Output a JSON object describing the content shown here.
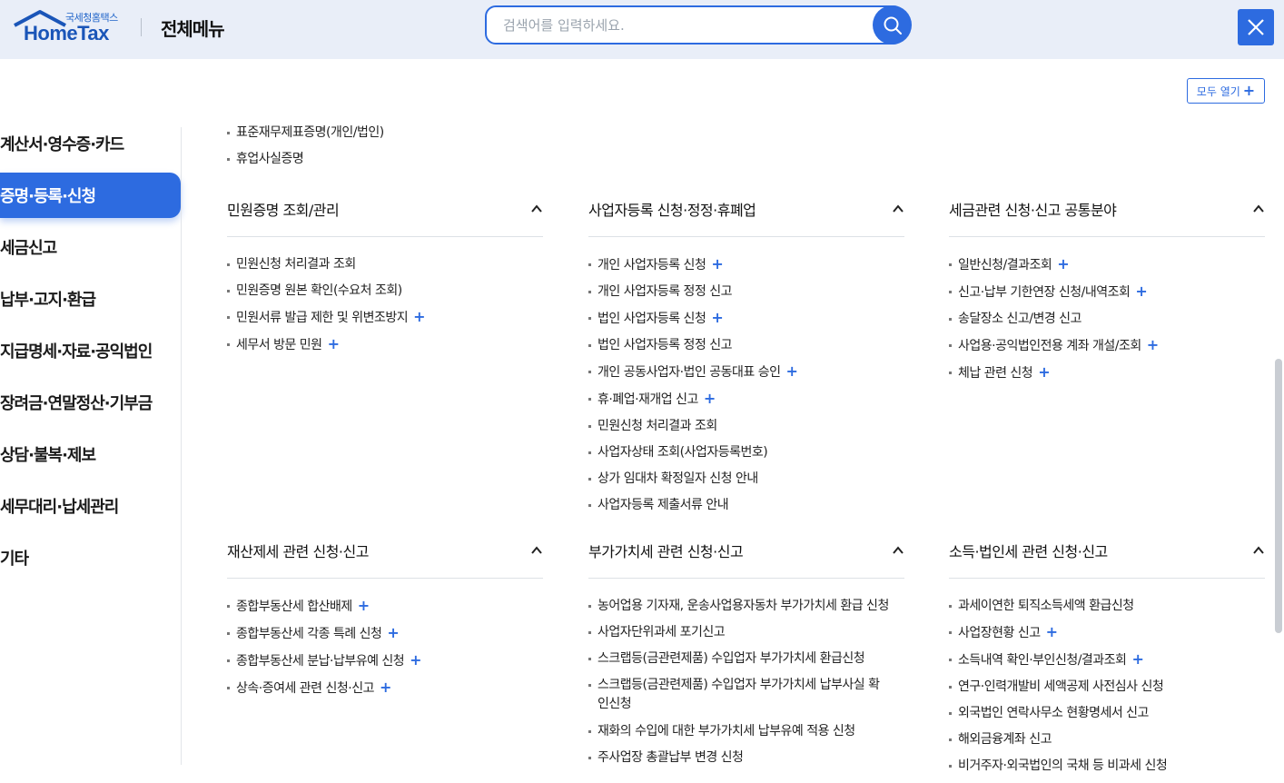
{
  "header": {
    "logo_sub": "국세청홈택스",
    "logo_main": "HomeTax",
    "title": "전체메뉴",
    "search_placeholder": "검색어를 입력하세요."
  },
  "toolbar": {
    "open_all_label": "모두 열기"
  },
  "sidebar": {
    "items": [
      {
        "label": "계산서·영수증·카드",
        "active": false
      },
      {
        "label": "증명·등록·신청",
        "active": true
      },
      {
        "label": "세금신고",
        "active": false
      },
      {
        "label": "납부·고지·환급",
        "active": false
      },
      {
        "label": "지급명세·자료·공익법인",
        "active": false
      },
      {
        "label": "장려금·연말정산·기부금",
        "active": false
      },
      {
        "label": "상담·불복·제보",
        "active": false
      },
      {
        "label": "세무대리·납세관리",
        "active": false
      },
      {
        "label": "기타",
        "active": false
      }
    ]
  },
  "top_items": [
    {
      "label": "표준재무제표증명(개인/법인)"
    },
    {
      "label": "휴업사실증명"
    }
  ],
  "sections": [
    {
      "title": "민원증명 조회/관리",
      "items": [
        {
          "label": "민원신청 처리결과 조회",
          "plus": false
        },
        {
          "label": "민원증명 원본 확인(수요처 조회)",
          "plus": false
        },
        {
          "label": "민원서류 발급 제한 및 위변조방지",
          "plus": true
        },
        {
          "label": "세무서 방문 민원",
          "plus": true
        }
      ]
    },
    {
      "title": "사업자등록 신청·정정·휴폐업",
      "items": [
        {
          "label": "개인 사업자등록 신청",
          "plus": true
        },
        {
          "label": "개인 사업자등록 정정 신고",
          "plus": false
        },
        {
          "label": "법인 사업자등록 신청",
          "plus": true
        },
        {
          "label": "법인 사업자등록 정정 신고",
          "plus": false
        },
        {
          "label": "개인 공동사업자·법인 공동대표 승인",
          "plus": true
        },
        {
          "label": "휴·폐업·재개업 신고",
          "plus": true
        },
        {
          "label": "민원신청 처리결과 조회",
          "plus": false
        },
        {
          "label": "사업자상태 조회(사업자등록번호)",
          "plus": false
        },
        {
          "label": "상가 임대차 확정일자 신청 안내",
          "plus": false
        },
        {
          "label": "사업자등록 제출서류 안내",
          "plus": false
        }
      ]
    },
    {
      "title": "세금관련 신청·신고 공통분야",
      "items": [
        {
          "label": "일반신청/결과조회",
          "plus": true
        },
        {
          "label": "신고·납부 기한연장 신청/내역조회",
          "plus": true
        },
        {
          "label": "송달장소 신고/변경 신고",
          "plus": false
        },
        {
          "label": "사업용·공익법인전용 계좌 개설/조회",
          "plus": true
        },
        {
          "label": "체납 관련 신청",
          "plus": true
        }
      ]
    },
    {
      "title": "재산제세 관련 신청·신고",
      "items": [
        {
          "label": "종합부동산세 합산배제",
          "plus": true
        },
        {
          "label": "종합부동산세 각종 특례 신청",
          "plus": true
        },
        {
          "label": "종합부동산세 분납·납부유예 신청",
          "plus": true
        },
        {
          "label": "상속·증여세 관련 신청·신고",
          "plus": true
        }
      ]
    },
    {
      "title": "부가가치세 관련 신청·신고",
      "items": [
        {
          "label": "농어업용 기자재, 운송사업용자동차 부가가치세 환급 신청",
          "plus": false
        },
        {
          "label": "사업자단위과세 포기신고",
          "plus": false
        },
        {
          "label": "스크랩등(금관련제품) 수입업자 부가가치세 환급신청",
          "plus": false
        },
        {
          "label": "스크랩등(금관련제품) 수입업자 부가가치세 납부사실 확인신청",
          "plus": false,
          "wrap": true
        },
        {
          "label": "재화의 수입에 대한 부가가치세 납부유예 적용 신청",
          "plus": false
        },
        {
          "label": "주사업장 총괄납부 변경 신청",
          "plus": false
        }
      ]
    },
    {
      "title": "소득·법인세 관련 신청·신고",
      "items": [
        {
          "label": "과세이연한 퇴직소득세액 환급신청",
          "plus": false
        },
        {
          "label": "사업장현황 신고",
          "plus": true
        },
        {
          "label": "소득내역 확인·부인신청/결과조회",
          "plus": true
        },
        {
          "label": "연구·인력개발비 세액공제 사전심사 신청",
          "plus": false
        },
        {
          "label": "외국법인 연락사무소 현황명세서 신고",
          "plus": false
        },
        {
          "label": "해외금융계좌 신고",
          "plus": false
        },
        {
          "label": "비거주자·외국법인의 국채 등 비과세 신청",
          "plus": false
        }
      ]
    }
  ],
  "colors": {
    "accent": "#2d6be0",
    "header_bg": "#e9eef8"
  },
  "icons": {
    "search": "search-icon",
    "close": "close-icon",
    "collapse": "chevron-up-icon"
  }
}
